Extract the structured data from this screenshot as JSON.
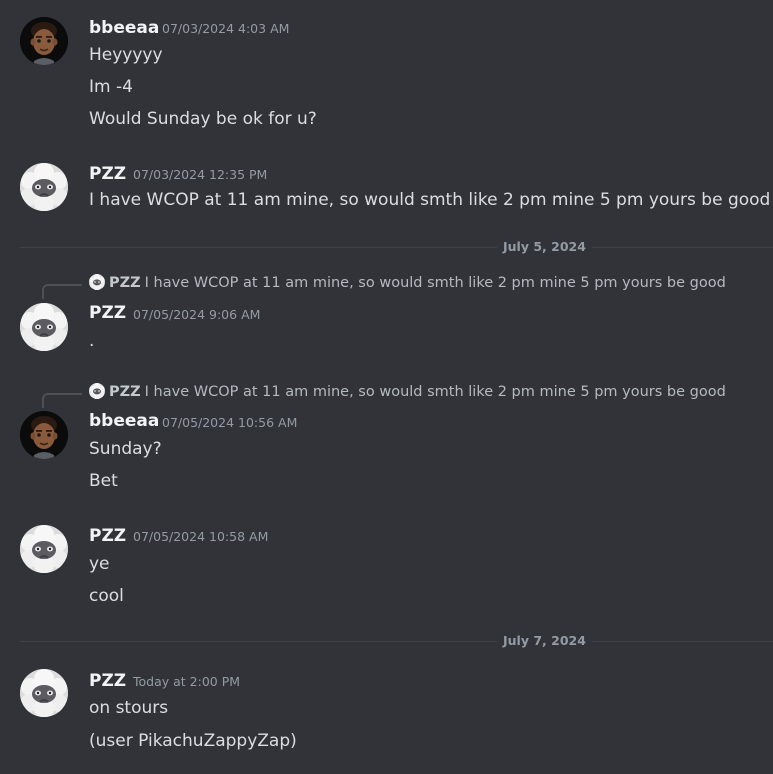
{
  "users": {
    "bbeeaa": "bbeeaa",
    "pzz": "PZZ"
  },
  "messages": [
    {
      "author": "bbeeaa",
      "timestamp": "07/03/2024 4:03 AM",
      "lines": [
        "Heyyyyy",
        "Im -4",
        "Would Sunday be ok for u?"
      ]
    },
    {
      "author": "PZZ",
      "timestamp": "07/03/2024 12:35 PM",
      "lines": [
        "I have WCOP at 11 am mine, so would smth like 2 pm mine 5 pm yours be good"
      ]
    },
    {
      "author": "PZZ",
      "timestamp": "07/05/2024 9:06 AM",
      "reply_to": {
        "author": "PZZ",
        "text": "I have WCOP at 11 am mine, so would smth like 2 pm mine 5 pm yours be good"
      },
      "lines": [
        "."
      ]
    },
    {
      "author": "bbeeaa",
      "timestamp": "07/05/2024 10:56 AM",
      "reply_to": {
        "author": "PZZ",
        "text": "I have WCOP at 11 am mine, so would smth like 2 pm mine 5 pm yours be good"
      },
      "lines": [
        "Sunday?",
        "Bet"
      ]
    },
    {
      "author": "PZZ",
      "timestamp": "07/05/2024 10:58 AM",
      "lines": [
        "ye",
        "cool"
      ]
    },
    {
      "author": "PZZ",
      "timestamp": "Today at 2:00 PM",
      "lines": [
        "on stours",
        "(user PikachuZappyZap)"
      ]
    }
  ],
  "dividers": [
    "July 5, 2024",
    "July 7, 2024"
  ],
  "colors": {
    "background": "#313338",
    "text": "#dbdee1",
    "username": "#f2f3f5",
    "muted": "#949ba4"
  },
  "icons": {
    "bbeeaa_avatar": "memoji-boy-avatar-icon",
    "pzz_avatar": "fluffy-sheep-avatar-icon"
  }
}
